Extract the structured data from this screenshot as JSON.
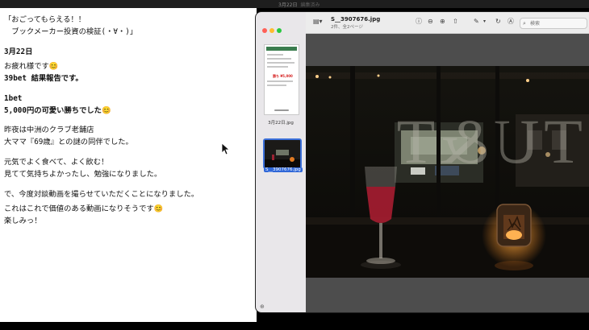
{
  "topbar": {
    "title": "3月22日",
    "subtitle": "編集済み"
  },
  "notes": {
    "lines": [
      "「おごってもらえる！！",
      "　ブックメーカー投資の検証(・∀・)」",
      "3月22日",
      "お疲れ様です😊",
      "39bet 結果報告です。",
      "1bet",
      "5,000円の可愛い勝ちでした😊",
      "昨夜は中洲のクラブ老舗店",
      "大ママ『69歳』との謎の同伴でした。",
      "元気でよく食べて、よく飲む！",
      "見てて気持ちよかったし、勉強になりました。",
      "で、今度対談動画を撮らせていただくことになりました。",
      "これはこれで価値のある動画になりそうです😊",
      "楽しみっ！"
    ]
  },
  "preview": {
    "file_title": "S__3907676.jpg",
    "file_subtitle": "2件、全2ページ",
    "search_placeholder": "検索",
    "thumbnails": [
      {
        "label": "3月22日.jpg",
        "thumb_text": "勝ち ¥5,000"
      },
      {
        "label": "S__3907676.jpg"
      }
    ]
  },
  "photo": {
    "window_text": "TU&T"
  },
  "colors": {
    "selection": "#2f67d8",
    "toolbar": "#ececec",
    "sidebar": "#e9e7ea",
    "canvas": "#4d4d4d",
    "drink": "#c0263a",
    "candle": "#ff9a2e"
  }
}
